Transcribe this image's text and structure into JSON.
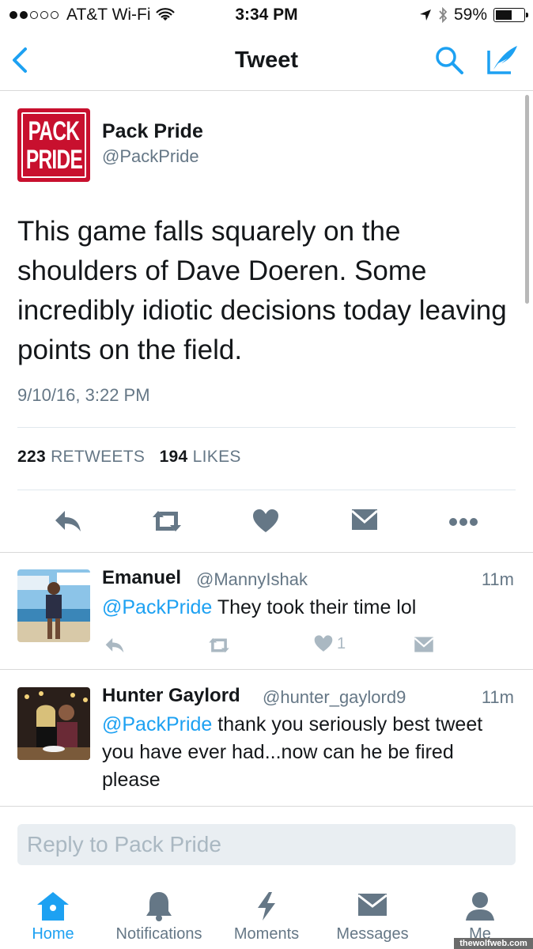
{
  "status_bar": {
    "carrier": "AT&T Wi-Fi",
    "time": "3:34 PM",
    "battery_percent": "59%",
    "battery_level": 0.59,
    "signal_bars_filled": 2,
    "signal_bars_total": 5
  },
  "nav": {
    "title": "Tweet",
    "icons": [
      "back-chevron-icon",
      "search-icon",
      "compose-icon"
    ]
  },
  "tweet": {
    "author_name": "Pack Pride",
    "author_handle": "@PackPride",
    "avatar_text_line1": "PACK",
    "avatar_text_line2": "PRIDE",
    "text": "This game falls squarely on the shoulders of Dave Doeren. Some incredibly idiotic decisions today leaving points on the field.",
    "timestamp": "9/10/16, 3:22 PM",
    "retweets_count": "223",
    "retweets_label": "RETWEETS",
    "likes_count": "194",
    "likes_label": "LIKES",
    "actions": [
      "reply-icon",
      "retweet-icon",
      "like-icon",
      "message-icon",
      "more-icon"
    ]
  },
  "replies": [
    {
      "name": "Emanuel",
      "handle": "@MannyIshak",
      "time": "11m",
      "mention": "@PackPride",
      "text": " They took their time lol",
      "like_count": "1"
    },
    {
      "name": "Hunter Gaylord",
      "handle": "@hunter_gaylord9",
      "time": "11m",
      "mention": "@PackPride",
      "text": " thank you seriously best tweet you have ever had...now can he be fired please"
    }
  ],
  "reply_box": {
    "placeholder": "Reply to Pack Pride"
  },
  "tabs": [
    {
      "label": "Home",
      "icon": "home-icon",
      "active": true
    },
    {
      "label": "Notifications",
      "icon": "bell-icon",
      "active": false
    },
    {
      "label": "Moments",
      "icon": "lightning-icon",
      "active": false
    },
    {
      "label": "Messages",
      "icon": "envelope-icon",
      "active": false
    },
    {
      "label": "Me",
      "icon": "person-icon",
      "active": false
    }
  ],
  "watermark": "thewolfweb.com",
  "colors": {
    "accent": "#1da1f2",
    "text": "#14171a",
    "secondary": "#657786",
    "icon_gray": "#aab8c2",
    "brand_red": "#c8102e"
  }
}
